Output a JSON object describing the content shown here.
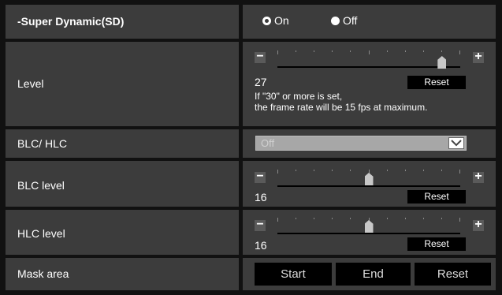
{
  "super_dynamic": {
    "label": "-Super Dynamic(SD)",
    "options": [
      {
        "label": "On",
        "selected": true
      },
      {
        "label": "Off",
        "selected": false
      }
    ]
  },
  "level": {
    "label": "Level",
    "value": "27",
    "slider_fraction": 0.9,
    "minus": "−",
    "plus": "+",
    "reset_label": "Reset",
    "note_line1": "If \"30\" or more is set,",
    "note_line2": "the frame rate will be 15 fps at maximum."
  },
  "blc_hlc": {
    "label": "BLC/ HLC",
    "selected_value": "Off"
  },
  "blc_level": {
    "label": "BLC level",
    "value": "16",
    "slider_fraction": 0.5,
    "minus": "−",
    "plus": "+",
    "reset_label": "Reset"
  },
  "hlc_level": {
    "label": "HLC level",
    "value": "16",
    "slider_fraction": 0.5,
    "minus": "−",
    "plus": "+",
    "reset_label": "Reset"
  },
  "mask_area": {
    "label": "Mask area",
    "start_label": "Start",
    "end_label": "End",
    "reset_label": "Reset"
  },
  "colors": {
    "row_background": "#3c3c3c",
    "page_background": "#111111",
    "knob": "#c8c8c8"
  }
}
